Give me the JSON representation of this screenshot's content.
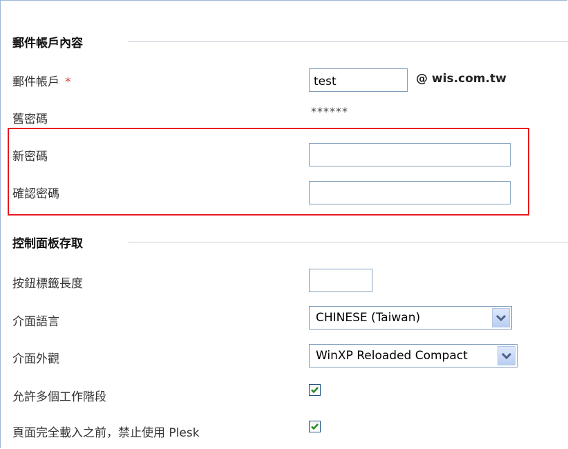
{
  "sections": {
    "account": {
      "title": "郵件帳戶內容"
    },
    "panel": {
      "title": "控制面板存取"
    }
  },
  "account": {
    "mail_label": "郵件帳戶",
    "required_mark": "*",
    "mail_value": "test",
    "domain": "@ wis.com.tw",
    "old_password_label": "舊密碼",
    "old_password_value": "******",
    "new_password_label": "新密碼",
    "new_password_value": "",
    "confirm_password_label": "確認密碼",
    "confirm_password_value": ""
  },
  "panel": {
    "button_label_length_label": "按鈕標籤長度",
    "button_label_length_value": "",
    "language_label": "介面語言",
    "language_value": "CHINESE (Taiwan)",
    "skin_label": "介面外觀",
    "skin_value": "WinXP Reloaded Compact",
    "multi_session_label": "允許多個工作階段",
    "multi_session_checked": true,
    "block_until_loaded_label": "頁面完全載入之前，禁止使用 Plesk",
    "block_until_loaded_checked": true
  },
  "colors": {
    "highlight_border": "#e8171f",
    "required": "#e53935",
    "check_mark": "#1e8a1e"
  }
}
